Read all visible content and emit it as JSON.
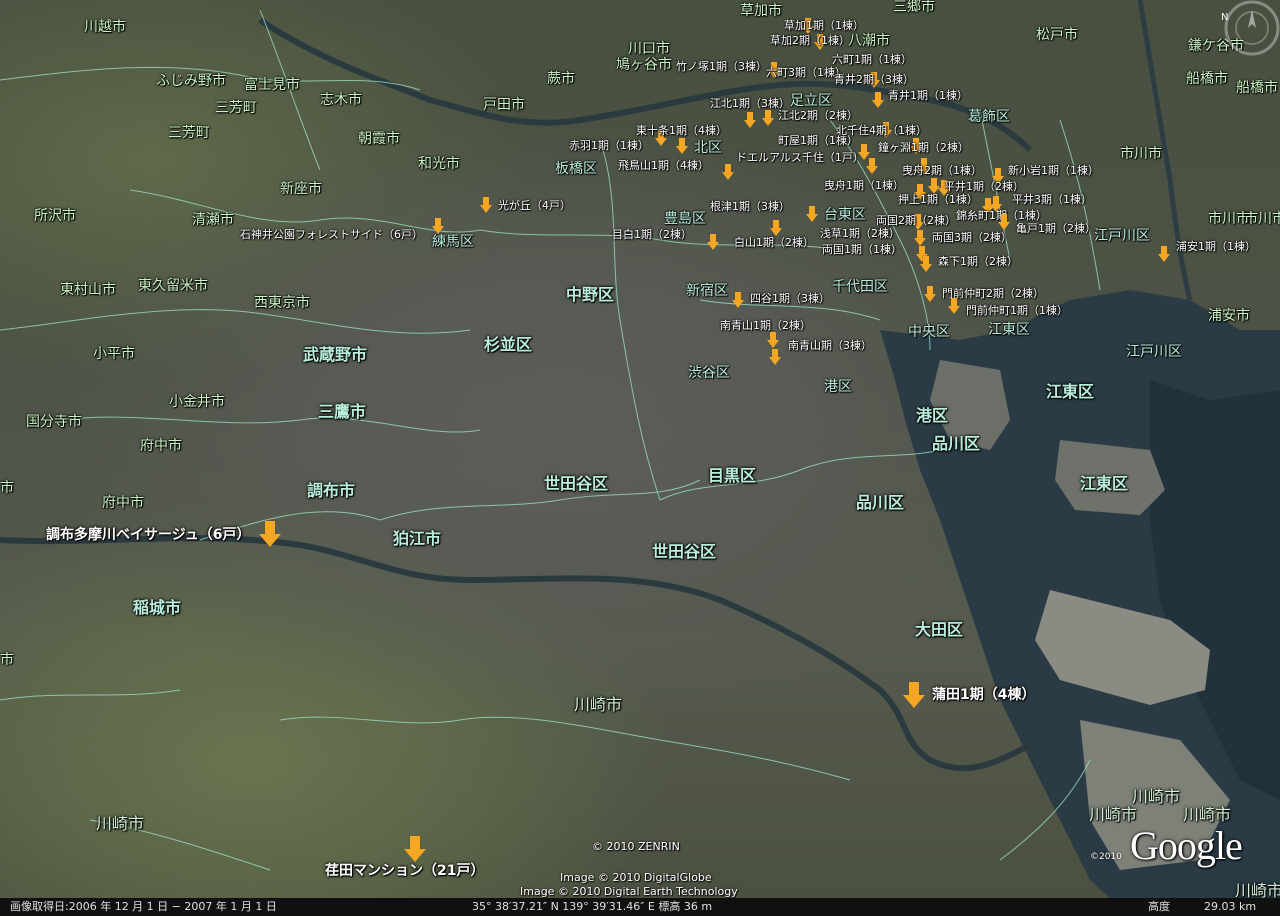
{
  "map": {
    "area_labels": [
      "川越市",
      "ふじみ野市",
      "富士見市",
      "三芳町",
      "志木市",
      "三芳町",
      "朝霞市",
      "和光市",
      "新座市",
      "所沢市",
      "清瀬市",
      "東村山市",
      "東久留米市",
      "西東京市",
      "小平市",
      "武蔵野市",
      "国分寺市",
      "小金井市",
      "府中市",
      "三鷹市",
      "府中市",
      "調布市",
      "狛江市",
      "稲城市",
      "市",
      "市",
      "川崎市",
      "川崎市",
      "川口市",
      "鳩ヶ谷市",
      "蕨市",
      "戸田市",
      "草加市",
      "八潮市",
      "三郷市",
      "松戸市",
      "鎌ケ谷市",
      "船橋市",
      "船橋市",
      "市川市",
      "市川市",
      "市川市",
      "浦安市",
      "川崎市",
      "川崎市",
      "川崎市",
      "川崎市"
    ],
    "ward_labels": [
      "板橋区",
      "北区",
      "足立区",
      "葛飾区",
      "練馬区",
      "豊島区",
      "台東区",
      "中野区",
      "新宿区",
      "千代田区",
      "杉並区",
      "中央区",
      "江東区",
      "渋谷区",
      "港区",
      "港区",
      "品川区",
      "江東区",
      "世田谷区",
      "目黒区",
      "品川区",
      "世田谷区",
      "江戸川区",
      "江戸川区",
      "江東区",
      "大田区"
    ],
    "pins": [
      {
        "label": "草加1期（1棟）"
      },
      {
        "label": "草加2期（1棟）"
      },
      {
        "label": "竹ノ塚1期（3棟）"
      },
      {
        "label": "六町3期（1棟）"
      },
      {
        "label": "六町1期（1棟）"
      },
      {
        "label": "青井2期（3棟）"
      },
      {
        "label": "青井1期（1棟）"
      },
      {
        "label": "江北1期（3棟）"
      },
      {
        "label": "江北2期（2棟）"
      },
      {
        "label": "東十条1期（4棟）"
      },
      {
        "label": "赤羽1期（1棟）"
      },
      {
        "label": "町屋1期（1棟）"
      },
      {
        "label": "北千住4期（1棟）"
      },
      {
        "label": "鐘ヶ淵1期（2棟）"
      },
      {
        "label": "ドエルアルス千住（1戸）"
      },
      {
        "label": "飛鳥山1期（4棟）"
      },
      {
        "label": "曳舟2期（1棟）"
      },
      {
        "label": "新小岩1期（1棟）"
      },
      {
        "label": "曳舟1期（1棟）"
      },
      {
        "label": "平井1期（2棟）"
      },
      {
        "label": "押上1期（1棟）"
      },
      {
        "label": "平井3期（1棟）"
      },
      {
        "label": "光が丘（4戸）"
      },
      {
        "label": "根津1期（3棟）"
      },
      {
        "label": "錦糸町1期（1棟）"
      },
      {
        "label": "両国2期（2棟）"
      },
      {
        "label": "亀戸1期（2棟）"
      },
      {
        "label": "石神井公園フォレストサイド（6戸）"
      },
      {
        "label": "目白1期（2棟）"
      },
      {
        "label": "浅草1期（2棟）"
      },
      {
        "label": "白山1期（2棟）"
      },
      {
        "label": "両国3期（2棟）"
      },
      {
        "label": "両国1期（1棟）"
      },
      {
        "label": "浦安1期（1棟）"
      },
      {
        "label": "森下1期（2棟）"
      },
      {
        "label": "門前仲町2期（2棟）"
      },
      {
        "label": "四谷1期（3棟）"
      },
      {
        "label": "門前仲町1期（1棟）"
      },
      {
        "label": "南青山1期（2棟）"
      },
      {
        "label": "南青山期（3棟）"
      },
      {
        "label": "調布多摩川ベイサージュ（6戸）"
      },
      {
        "label": "蒲田1期（4棟）"
      },
      {
        "label": "荏田マンション（21戸）"
      }
    ]
  },
  "credits": {
    "zenrin": "© 2010 ZENRIN",
    "digitalglobe": "Image © 2010 DigitalGlobe",
    "digitalearth": "Image © 2010 Digital Earth Technology",
    "google_year": "©2010",
    "google": "Google"
  },
  "statusbar": {
    "imagery_date": "画像取得日:2006 年 12 月 1 日 − 2007 年 1 月 1 日",
    "coords": "35° 38′37.21″ N    139° 39′31.46″ E   標高   36 m",
    "alt_label": "高度",
    "alt_value": "29.03 km"
  },
  "colors": {
    "pin": "#f5a623",
    "label": "#b9eedc",
    "water": "#1f3a4a"
  }
}
